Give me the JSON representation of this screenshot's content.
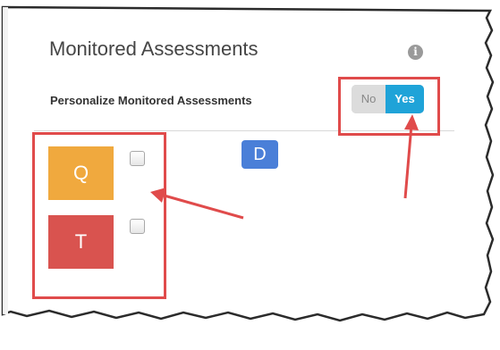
{
  "panel": {
    "title": "Monitored Assessments",
    "info_icon": "info-circle-icon",
    "subtitle": "Personalize Monitored Assessments",
    "toggle": {
      "off_label": "No",
      "on_label": "Yes",
      "selected": "Yes"
    }
  },
  "assessments": [
    {
      "label": "Q",
      "color": "#f0a93e",
      "checked": false
    },
    {
      "label": "T",
      "color": "#d9534f",
      "checked": false
    }
  ],
  "extra_tile": {
    "label": "D",
    "color": "#4a7fd8"
  },
  "annotations": {
    "highlight_color": "#e04b4b",
    "arrows": [
      "arrow-to-tiles",
      "arrow-to-toggle"
    ]
  }
}
